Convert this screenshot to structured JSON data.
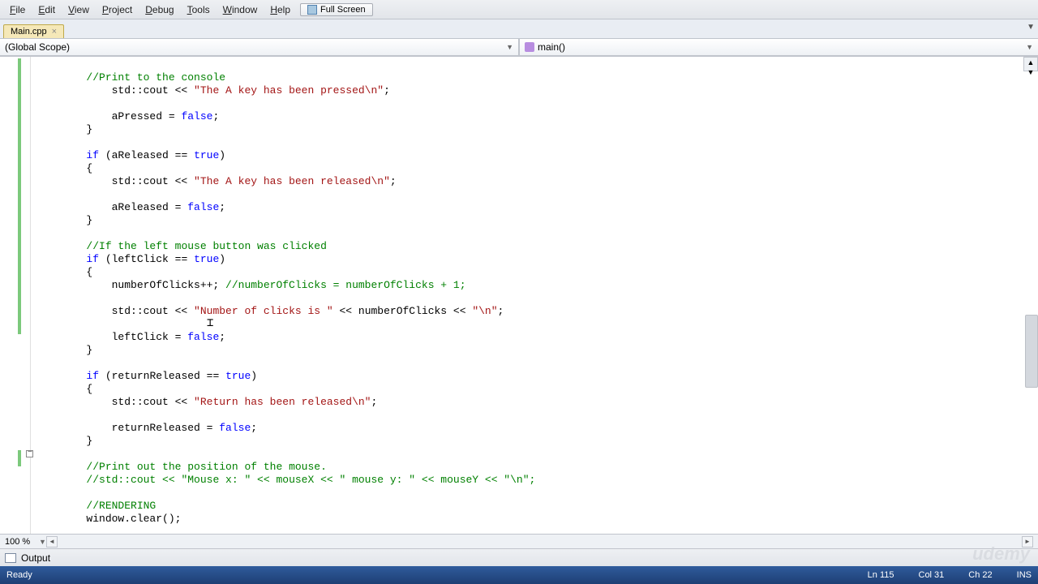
{
  "menu": {
    "file": "File",
    "edit": "Edit",
    "view": "View",
    "project": "Project",
    "debug": "Debug",
    "tools": "Tools",
    "window": "Window",
    "help": "Help",
    "fullscreen": "Full Screen"
  },
  "tab": {
    "name": "Main.cpp"
  },
  "scope": {
    "left": "(Global Scope)",
    "right": "main()"
  },
  "zoom": "100 %",
  "outputPanel": "Output",
  "status": {
    "ready": "Ready",
    "line": "Ln 115",
    "col": "Col 31",
    "ch": "Ch 22",
    "ins": "INS"
  },
  "watermark": "udemy",
  "code": {
    "l01a": "        ",
    "l01b": "//Print to the console",
    "l02a": "            std::cout << ",
    "l02b": "\"The A key has been pressed\\n\"",
    "l02c": ";",
    "l03": "",
    "l04a": "            aPressed = ",
    "l04b": "false",
    "l04c": ";",
    "l05": "        }",
    "l06": "",
    "l07a": "        ",
    "l07b": "if",
    "l07c": " (aReleased == ",
    "l07d": "true",
    "l07e": ")",
    "l08": "        {",
    "l09a": "            std::cout << ",
    "l09b": "\"The A key has been released\\n\"",
    "l09c": ";",
    "l10": "",
    "l11a": "            aReleased = ",
    "l11b": "false",
    "l11c": ";",
    "l12": "        }",
    "l13": "",
    "l14a": "        ",
    "l14b": "//If the left mouse button was clicked",
    "l15a": "        ",
    "l15b": "if",
    "l15c": " (leftClick == ",
    "l15d": "true",
    "l15e": ")",
    "l16": "        {",
    "l17a": "            numberOfClicks++; ",
    "l17b": "//numberOfClicks = numberOfClicks + 1;",
    "l18": "",
    "l19a": "            std::cout << ",
    "l19b": "\"Number of clicks is \"",
    "l19c": " << numberOfClicks << ",
    "l19d": "\"\\n\"",
    "l19e": ";",
    "l20": "",
    "l21a": "            leftClick = ",
    "l21b": "false",
    "l21c": ";",
    "l22": "        }",
    "l23": "",
    "l24a": "        ",
    "l24b": "if",
    "l24c": " (returnReleased == ",
    "l24d": "true",
    "l24e": ")",
    "l25": "        {",
    "l26a": "            std::cout << ",
    "l26b": "\"Return has been released\\n\"",
    "l26c": ";",
    "l27": "",
    "l28a": "            returnReleased = ",
    "l28b": "false",
    "l28c": ";",
    "l29": "        }",
    "l30": "",
    "l31a": "        ",
    "l31b": "//Print out the position of the mouse.",
    "l32a": "        ",
    "l32b": "//std::cout << \"Mouse x: \" << mouseX << \" mouse y: \" << mouseY << \"\\n\";",
    "l33": "",
    "l34a": "        ",
    "l34b": "//RENDERING",
    "l35": "        window.clear();"
  }
}
